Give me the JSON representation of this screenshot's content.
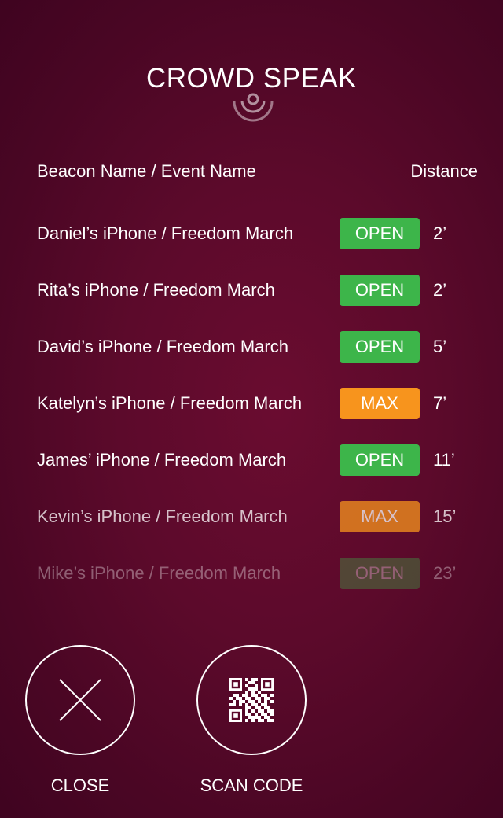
{
  "app": {
    "title": "CROWD SPEAK",
    "logo_icon": "broadcast-signal-icon"
  },
  "table": {
    "header_name": "Beacon Name / Event Name",
    "header_distance": "Distance",
    "rows": [
      {
        "name": "Daniel’s iPhone / Freedom March",
        "status": "OPEN",
        "distance": "2’"
      },
      {
        "name": "Rita’s iPhone / Freedom March",
        "status": "OPEN",
        "distance": "2’"
      },
      {
        "name": "David’s iPhone / Freedom March",
        "status": "OPEN",
        "distance": "5’"
      },
      {
        "name": "Katelyn’s iPhone / Freedom March",
        "status": "MAX",
        "distance": "7’"
      },
      {
        "name": "James’ iPhone / Freedom March",
        "status": "OPEN",
        "distance": "11’"
      },
      {
        "name": "Kevin’s iPhone / Freedom March",
        "status": "MAX",
        "distance": "15’"
      },
      {
        "name": "Mike’s iPhone / Freedom March",
        "status": "OPEN",
        "distance": "23’"
      }
    ]
  },
  "actions": {
    "close_label": "CLOSE",
    "close_icon": "close-icon",
    "scan_label": "SCAN CODE",
    "scan_icon": "qr-code-icon"
  },
  "colors": {
    "background": "#5c0a2b",
    "open": "#3db54a",
    "max": "#f7941d",
    "text": "#ffffff"
  }
}
